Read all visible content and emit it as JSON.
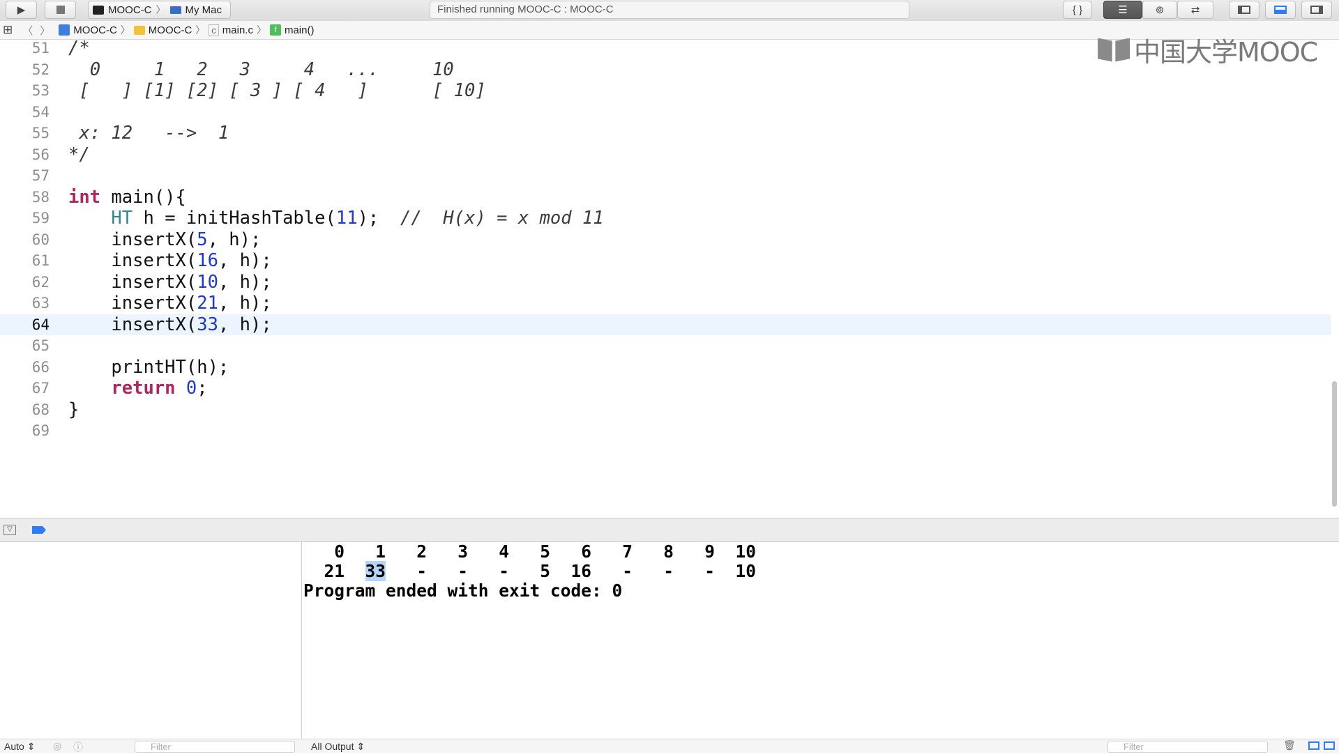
{
  "toolbar": {
    "scheme": "MOOC-C",
    "destination": "My Mac",
    "activity": "Finished running MOOC-C : MOOC-C"
  },
  "jumpbar": {
    "items": [
      "MOOC-C",
      "MOOC-C",
      "main.c",
      "main()"
    ]
  },
  "editor": {
    "lines": [
      {
        "n": "51",
        "html": "<span class='cm'>/*</span>"
      },
      {
        "n": "52",
        "html": "<span class='cm'>  0     1   2   3     4   ...     10</span>"
      },
      {
        "n": "53",
        "html": "<span class='cm'> [   ] [1] [2] [ 3 ] [ 4   ]      [ 10]</span>"
      },
      {
        "n": "54",
        "html": ""
      },
      {
        "n": "55",
        "html": "<span class='cm'> x: 12   --&gt;  1</span>"
      },
      {
        "n": "56",
        "html": "<span class='cm'>*/</span>"
      },
      {
        "n": "57",
        "html": ""
      },
      {
        "n": "58",
        "html": "<span class='kw'>int</span> main(){"
      },
      {
        "n": "59",
        "html": "    <span class='ty'>HT</span> h = initHashTable(<span class='num'>11</span>);  <span class='cm'>//  H(x) = x mod 11</span>"
      },
      {
        "n": "60",
        "html": "    insertX(<span class='num'>5</span>, h);"
      },
      {
        "n": "61",
        "html": "    insertX(<span class='num'>16</span>, h);"
      },
      {
        "n": "62",
        "html": "    insertX(<span class='num'>10</span>, h);"
      },
      {
        "n": "63",
        "html": "    insertX(<span class='num'>21</span>, h);"
      },
      {
        "n": "64",
        "html": "    insertX(<span class='num'>33</span>, h);"
      },
      {
        "n": "65",
        "html": ""
      },
      {
        "n": "66",
        "html": "    printHT(h);"
      },
      {
        "n": "67",
        "html": "    <span class='kw'>return</span> <span class='num'>0</span>;"
      },
      {
        "n": "68",
        "html": "}"
      },
      {
        "n": "69",
        "html": ""
      }
    ],
    "current_line": "64"
  },
  "logo": "中国大学MOOC",
  "console": {
    "header_row": "   0   1   2   3   4   5   6   7   8   9  10",
    "value_row_pre": "  21  ",
    "value_row_hl": "33",
    "value_row_post": "   -   -   -   5  16   -   -   -  10",
    "exit_line": "Program ended with exit code: 0"
  },
  "bottom": {
    "auto_label": "Auto ⇕",
    "filter_left_placeholder": "Filter",
    "output_label": "All Output ⇕",
    "filter_right_placeholder": "Filter"
  },
  "icons": {
    "run": "play-icon",
    "stop": "stop-icon",
    "accent": "#2f7cf6"
  }
}
